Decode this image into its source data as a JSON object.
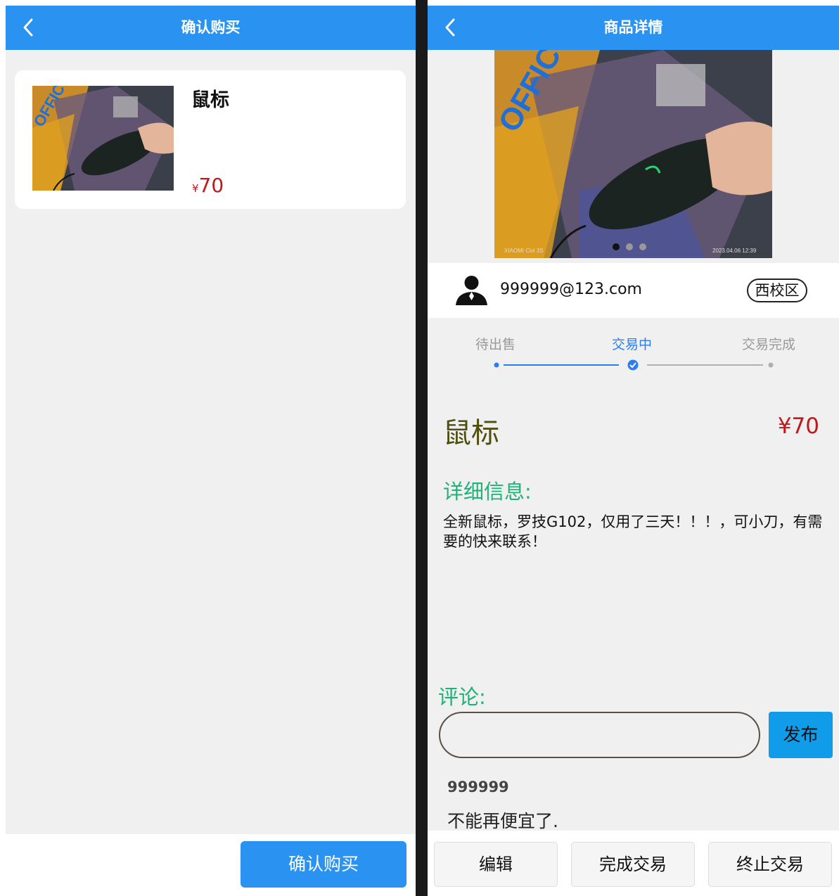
{
  "confirm_screen": {
    "title": "确认购买",
    "product": {
      "name": "鼠标",
      "price_symbol": "¥",
      "price": "70"
    },
    "confirm_button": "确认购买"
  },
  "detail_screen": {
    "title": "商品详情",
    "image_dots": {
      "count": 3,
      "active": 0
    },
    "seller": {
      "email": "999999@123.com",
      "campus": "西校区"
    },
    "steps": {
      "items": [
        "待出售",
        "交易中",
        "交易完成"
      ],
      "current": 1
    },
    "product": {
      "name": "鼠标",
      "price": "¥70"
    },
    "detail": {
      "heading": "详细信息:",
      "text": "全新鼠标，罗技G102，仅用了三天！！！，可小刀，有需要的快来联系！"
    },
    "comments": {
      "heading": "评论:",
      "input_value": "",
      "post_button": "发布",
      "items": [
        {
          "user": "999999",
          "text": "不能再便宜了."
        }
      ]
    },
    "actions": {
      "edit": "编辑",
      "complete": "完成交易",
      "terminate": "终止交易"
    }
  },
  "colors": {
    "nav_bar": "#2a92f0",
    "price_red": "#c2181b",
    "heading_green": "#22b07a",
    "step_active": "#2a7ef0",
    "step_inactive": "#9a9a9a",
    "post_button": "#109ce8"
  },
  "icons": [
    "back-arrow-icon",
    "user-avatar-icon",
    "step-check-icon"
  ]
}
